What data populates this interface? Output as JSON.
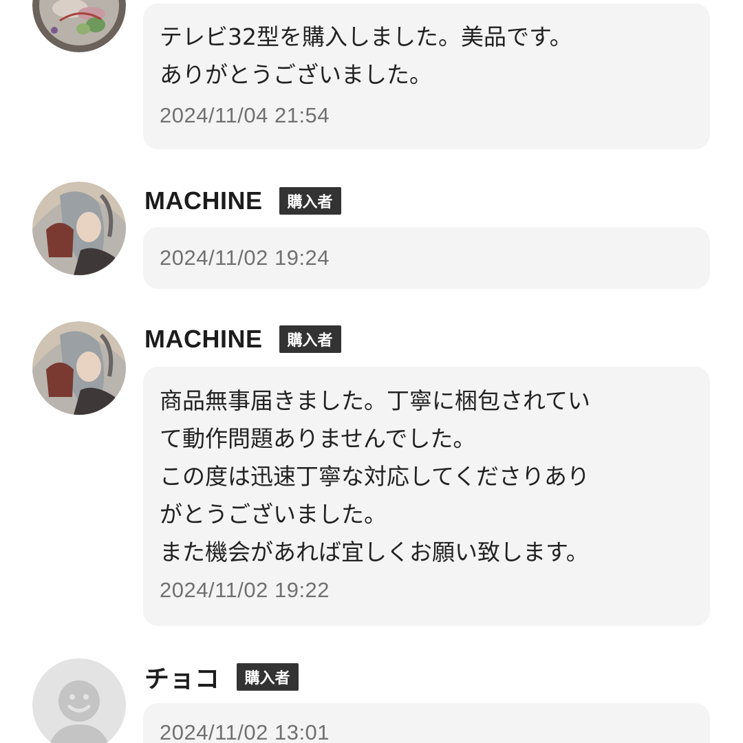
{
  "reviews": [
    {
      "user": "",
      "badge": "",
      "comment": "テレビ32型を購入しました。美品です。\nありがとうございました。",
      "timestamp": "2024/11/04 21:54"
    },
    {
      "user": "MACHINE",
      "badge": "購入者",
      "comment": "",
      "timestamp": "2024/11/02 19:24"
    },
    {
      "user": "MACHINE",
      "badge": "購入者",
      "comment": "商品無事届きました。丁寧に梱包されてい\nて動作問題ありませんでした。\nこの度は迅速丁寧な対応してくださりあり\nがとうございました。\nまた機会があれば宜しくお願い致します。",
      "timestamp": "2024/11/02 19:22"
    },
    {
      "user": "チョコ",
      "badge": "購入者",
      "comment": "",
      "timestamp": "2024/11/02 13:01"
    }
  ],
  "icons": {
    "review_0_avatar": "food-photo-avatar",
    "review_1_avatar": "anime-character-avatar",
    "review_2_avatar": "anime-character-avatar",
    "review_3_avatar": "default-user-avatar"
  },
  "colors": {
    "bubble_background": "#f4f4f4",
    "badge_background": "#333333",
    "timestamp_text": "#707070"
  }
}
